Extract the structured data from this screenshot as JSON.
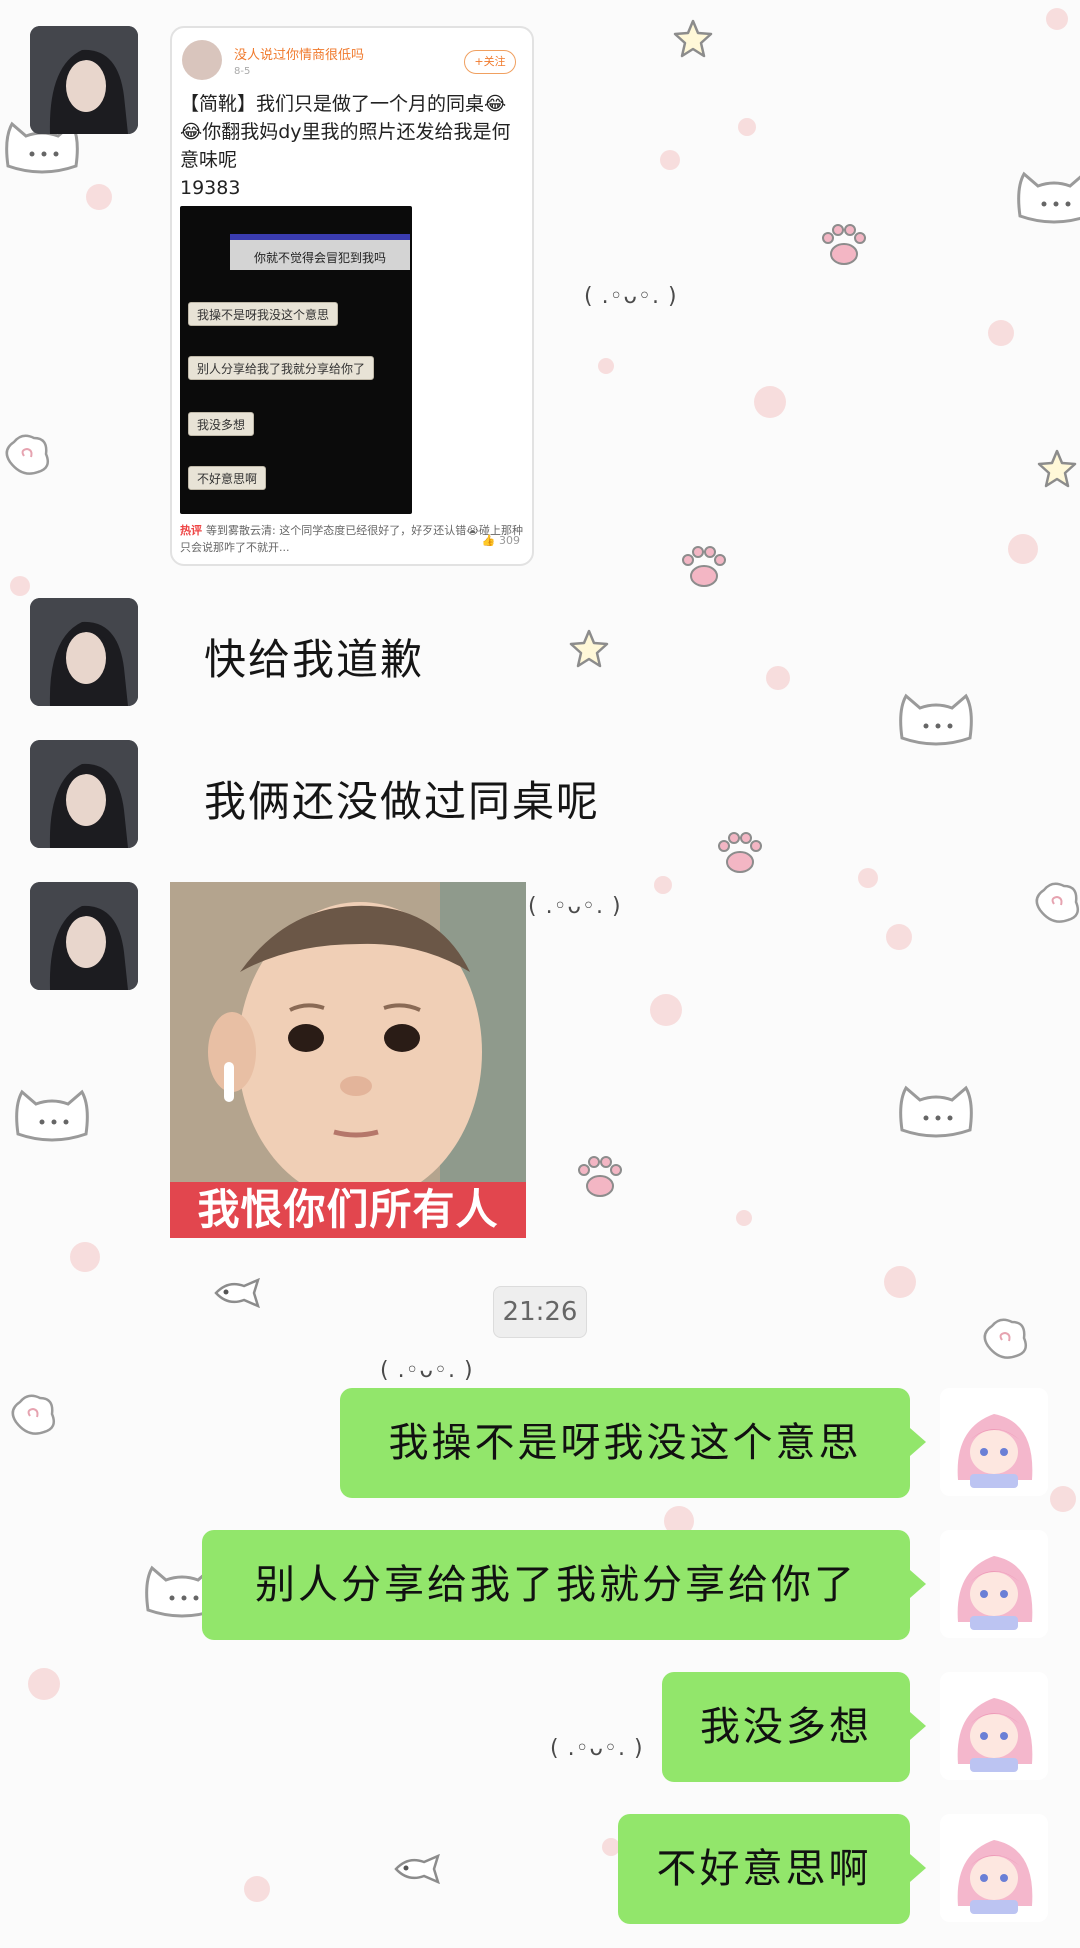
{
  "chat": {
    "card": {
      "author": "没人说过你情商很低吗",
      "date": "8-5",
      "follow_label": "+关注",
      "text": "【简靴】我们只是做了一个月的同桌😂😂你翻我妈dy里我的照片还发给我是何意味呢",
      "count": "19383",
      "screenshot_lines": [
        "你就不觉得会冒犯到我吗",
        "我操不是呀我没这个意思",
        "别人分享给我了我就分享给你了",
        "我没多想",
        "不好意思啊"
      ],
      "comment_hot": "热评",
      "comment_text": "等到雾散云清: 这个同学态度已经很好了，好歹还认错😭碰上那种只会说那咋了不就开...",
      "comment_likes": "309"
    },
    "received_text_1": "快给我道歉",
    "received_text_2": "我俩还没做过同桌呢",
    "meme_caption": "我恨你们所有人",
    "timestamp": "21:26",
    "sent": [
      "我操不是呀我没这个意思",
      "别人分享给我了我就分享给你了",
      "我没多想",
      "不好意思啊"
    ]
  },
  "decor": {
    "kaomoji": "( .◦ᴗ◦. )"
  },
  "colors": {
    "bubble": "#92e66b",
    "background": "#fbfbfb",
    "meme_caption": "#e2464e"
  }
}
